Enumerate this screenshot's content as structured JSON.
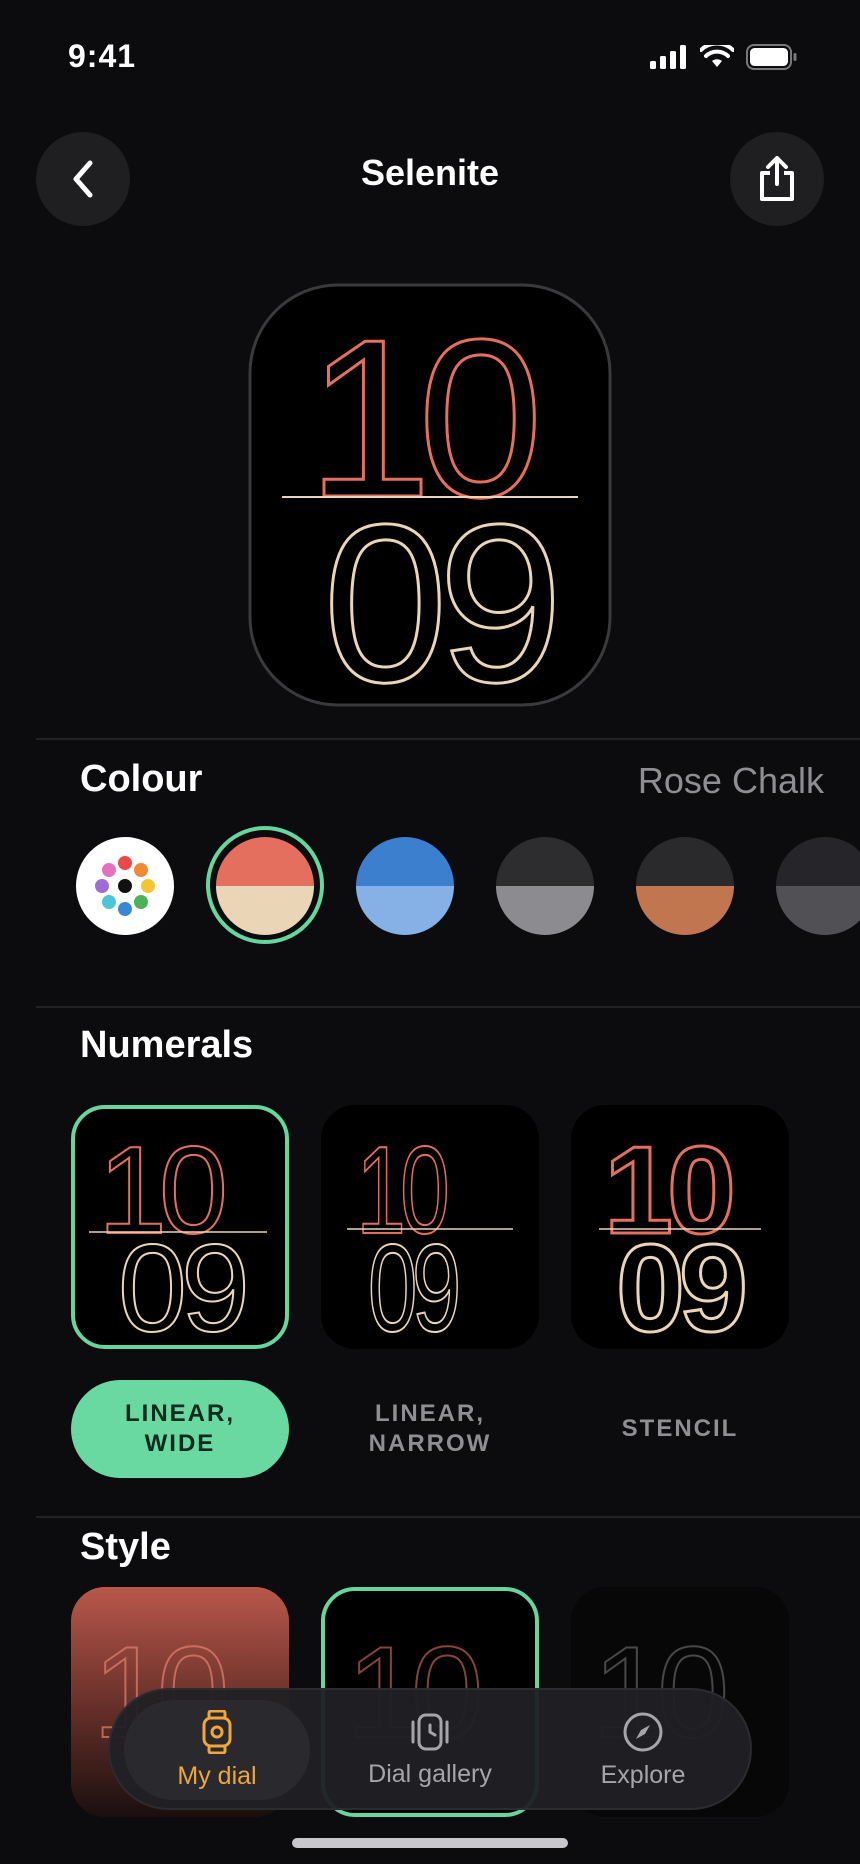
{
  "status_bar": {
    "time": "9:41"
  },
  "header": {
    "title": "Selenite"
  },
  "preview": {
    "hour": "10",
    "minute": "09"
  },
  "colour": {
    "section_title": "Colour",
    "selected_name": "Rose Chalk",
    "swatches": [
      {
        "name": "multicolor",
        "top": "#ffffff",
        "bottom": "#ffffff"
      },
      {
        "name": "rose-chalk",
        "top": "#e56f5f",
        "bottom": "#ead6b7"
      },
      {
        "name": "blue",
        "top": "#3c7fcf",
        "bottom": "#86b1e6"
      },
      {
        "name": "gray",
        "top": "#2d2d30",
        "bottom": "#8b8b90"
      },
      {
        "name": "copper",
        "top": "#2a2a2d",
        "bottom": "#c2764f"
      },
      {
        "name": "dark-gray",
        "top": "#26262a",
        "bottom": "#505055"
      }
    ]
  },
  "numerals": {
    "section_title": "Numerals",
    "options": [
      {
        "label": "LINEAR,\nWIDE",
        "hour": "10",
        "minute": "09"
      },
      {
        "label": "LINEAR,\nNARROW",
        "hour": "10",
        "minute": "09"
      },
      {
        "label": "STENCIL",
        "hour": "10",
        "minute": "09"
      }
    ],
    "selected_index": 0
  },
  "style": {
    "section_title": "Style",
    "cards": [
      {
        "hour": "10"
      },
      {
        "hour": "10"
      },
      {
        "hour": "10"
      }
    ]
  },
  "tabbar": {
    "tabs": [
      {
        "label": "My dial",
        "icon": "watch-icon"
      },
      {
        "label": "Dial gallery",
        "icon": "watch-gallery-icon"
      },
      {
        "label": "Explore",
        "icon": "compass-icon"
      }
    ],
    "active_index": 0
  },
  "colors": {
    "accent_green": "#66d59e",
    "accent_orange": "#f0a63a",
    "rose": "#e56f5f",
    "chalk": "#ead6b7"
  }
}
